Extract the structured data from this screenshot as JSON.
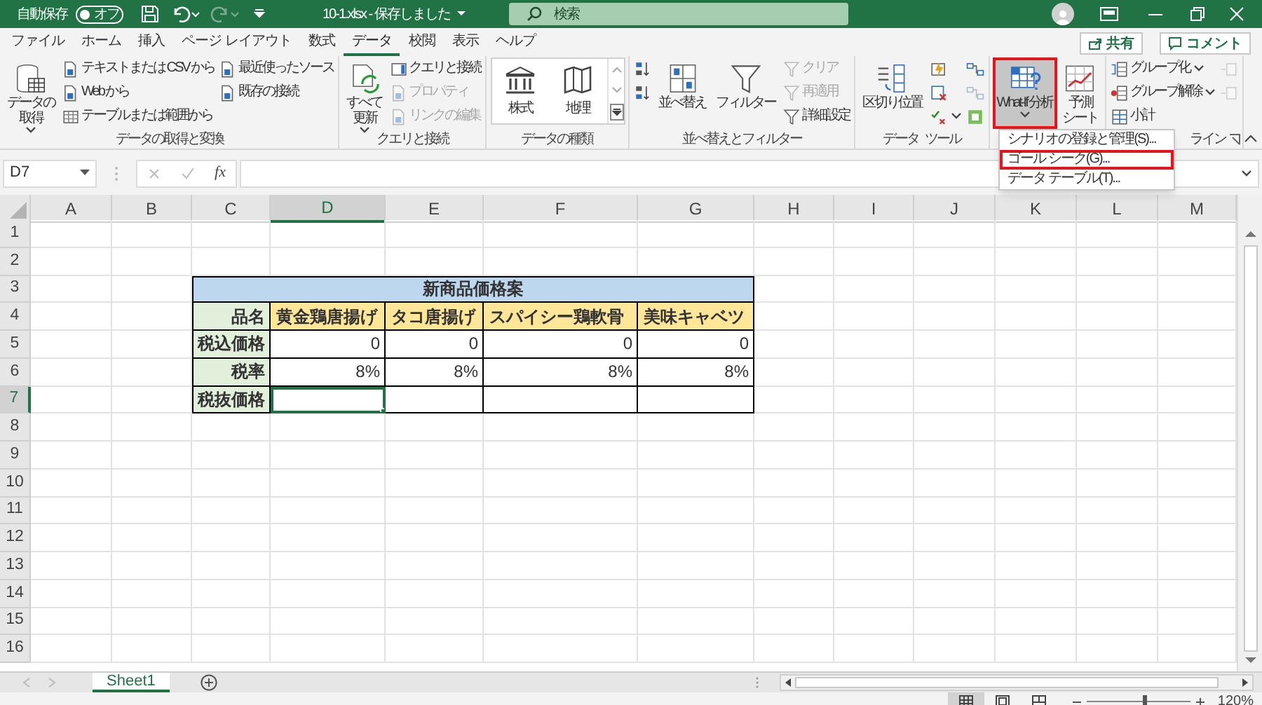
{
  "title_bar": {
    "autosave_label": "自動保存",
    "autosave": {
      "on": false,
      "label": "オフ"
    },
    "redo": {
      "disabled": true
    },
    "title": "10-1.xlsx - 保存しました",
    "search": {
      "placeholder": "検索"
    }
  },
  "menu_tabs": [
    {
      "label": "ファイル",
      "selected": false
    },
    {
      "label": "ホーム",
      "selected": false
    },
    {
      "label": "挿入",
      "selected": false
    },
    {
      "label": "ページ レイアウト",
      "selected": false
    },
    {
      "label": "数式",
      "selected": false
    },
    {
      "label": "データ",
      "selected": true
    },
    {
      "label": "校閲",
      "selected": false
    },
    {
      "label": "表示",
      "selected": false
    },
    {
      "label": "ヘルプ",
      "selected": false
    }
  ],
  "share_button": "共有",
  "comment_button": "コメント",
  "ribbon": {
    "groups": [
      {
        "label": "データの取得と変換",
        "items": [
          {
            "kind": "large",
            "lines": [
              "データの",
              "取得"
            ],
            "dropdown": true,
            "expanded": false,
            "highlighted": false
          },
          {
            "kind": "column",
            "buttons": [
              {
                "label": "テキストまたは CSV から",
                "disabled": false,
                "dropdown": false
              },
              {
                "label": "Web から",
                "disabled": false,
                "dropdown": false
              },
              {
                "label": "テーブルまたは範囲から",
                "disabled": false,
                "dropdown": false
              }
            ]
          },
          {
            "kind": "column",
            "buttons": [
              {
                "label": "最近使ったソース",
                "disabled": false,
                "dropdown": false
              },
              {
                "label": "既存の接続",
                "disabled": false,
                "dropdown": false
              }
            ]
          }
        ]
      },
      {
        "label": "クエリと接続",
        "items": [
          {
            "kind": "large",
            "lines": [
              "すべて",
              "更新"
            ],
            "dropdown": true,
            "expanded": false,
            "highlighted": false
          },
          {
            "kind": "column",
            "buttons": [
              {
                "label": "クエリと接続",
                "disabled": false,
                "dropdown": false
              },
              {
                "label": "プロパティ",
                "disabled": true,
                "dropdown": false
              },
              {
                "label": "リンクの編集",
                "disabled": true,
                "dropdown": false
              }
            ]
          }
        ]
      },
      {
        "label": "データの種類",
        "items": [
          {
            "kind": "gallery",
            "entries": [
              "株式",
              "地理"
            ]
          }
        ]
      },
      {
        "label": "並べ替えとフィルター",
        "items": [
          {
            "kind": "column",
            "buttons": [
              {
                "disabled": false,
                "dropdown": false
              },
              {
                "disabled": false,
                "dropdown": false
              }
            ]
          },
          {
            "kind": "large",
            "lines": [
              "並べ替え"
            ],
            "dropdown": false,
            "expanded": false,
            "highlighted": false
          },
          {
            "kind": "large",
            "lines": [
              "フィルター"
            ],
            "dropdown": false,
            "expanded": false,
            "highlighted": false
          },
          {
            "kind": "column",
            "buttons": [
              {
                "label": "クリア",
                "disabled": true,
                "dropdown": false
              },
              {
                "label": "再適用",
                "disabled": true,
                "dropdown": false
              },
              {
                "label": "詳細設定",
                "disabled": false,
                "dropdown": false
              }
            ]
          }
        ]
      },
      {
        "label": "データ ツール",
        "items": [
          {
            "kind": "large",
            "lines": [
              "区切り位置"
            ],
            "dropdown": false,
            "expanded": false,
            "highlighted": false
          },
          {
            "kind": "column",
            "buttons": [
              {
                "disabled": false,
                "dropdown": false
              },
              {
                "disabled": false,
                "dropdown": false
              },
              {
                "disabled": false,
                "dropdown": true
              }
            ]
          },
          {
            "kind": "column",
            "buttons": [
              {
                "disabled": false,
                "dropdown": false
              },
              {
                "disabled": true,
                "dropdown": false
              },
              {
                "disabled": false,
                "dropdown": false
              }
            ]
          }
        ]
      },
      {
        "items": [
          {
            "kind": "large",
            "lines": [
              "What-If 分析"
            ],
            "dropdown": true,
            "expanded": true,
            "highlighted": true
          },
          {
            "kind": "large",
            "lines": [
              "予測",
              "シート"
            ],
            "dropdown": false,
            "expanded": false,
            "highlighted": false
          }
        ]
      },
      {
        "label": "ライン",
        "items": [
          {
            "kind": "column",
            "buttons": [
              {
                "label": "グループ化",
                "disabled": false,
                "dropdown": true
              },
              {
                "label": "グループ解除",
                "disabled": false,
                "dropdown": true
              },
              {
                "label": "小計",
                "disabled": false,
                "dropdown": false
              }
            ]
          },
          {
            "kind": "column",
            "buttons": [
              {
                "disabled": true,
                "dropdown": false
              },
              {
                "disabled": true,
                "dropdown": false
              }
            ]
          }
        ]
      }
    ]
  },
  "what_if_menu": [
    {
      "label": "シナリオの登録と管理(S)...",
      "highlighted": false
    },
    {
      "label": "ゴール シーク(G)...",
      "highlighted": true
    },
    {
      "label": "データ テーブル(T)...",
      "highlighted": false
    }
  ],
  "formula_bar": {
    "name_box": "D7",
    "function_label": "fx"
  },
  "sheet": {
    "columns": [
      {
        "label": "A",
        "selected": false
      },
      {
        "label": "B",
        "selected": false
      },
      {
        "label": "C",
        "selected": false
      },
      {
        "label": "D",
        "selected": true
      },
      {
        "label": "E",
        "selected": false
      },
      {
        "label": "F",
        "selected": false
      },
      {
        "label": "G",
        "selected": false
      },
      {
        "label": "H",
        "selected": false
      },
      {
        "label": "I",
        "selected": false
      },
      {
        "label": "J",
        "selected": false
      },
      {
        "label": "K",
        "selected": false
      },
      {
        "label": "L",
        "selected": false
      },
      {
        "label": "M",
        "selected": false
      }
    ],
    "rows": [
      {
        "label": "1",
        "selected": false
      },
      {
        "label": "2",
        "selected": false
      },
      {
        "label": "3",
        "selected": false
      },
      {
        "label": "4",
        "selected": false
      },
      {
        "label": "5",
        "selected": false
      },
      {
        "label": "6",
        "selected": false
      },
      {
        "label": "7",
        "selected": true
      },
      {
        "label": "8",
        "selected": false
      },
      {
        "label": "9",
        "selected": false
      },
      {
        "label": "10",
        "selected": false
      },
      {
        "label": "11",
        "selected": false
      },
      {
        "label": "12",
        "selected": false
      },
      {
        "label": "13",
        "selected": false
      },
      {
        "label": "14",
        "selected": false
      },
      {
        "label": "15",
        "selected": false
      },
      {
        "label": "16",
        "selected": false
      }
    ]
  },
  "table": {
    "title": "新商品価格案",
    "header_label": "品名",
    "items": [
      "黄金鶏唐揚げ",
      "タコ唐揚げ",
      "スパイシー鶏軟骨",
      "美味キャベツ"
    ],
    "rows": [
      {
        "label": "税込価格",
        "cells": [
          {
            "text": "0",
            "selected": false
          },
          {
            "text": "0",
            "selected": false
          },
          {
            "text": "0",
            "selected": false
          },
          {
            "text": "0",
            "selected": false
          }
        ]
      },
      {
        "label": "税率",
        "cells": [
          {
            "text": "8%",
            "selected": false
          },
          {
            "text": "8%",
            "selected": false
          },
          {
            "text": "8%",
            "selected": false
          },
          {
            "text": "8%",
            "selected": false
          }
        ]
      },
      {
        "label": "税抜価格",
        "cells": [
          {
            "selected": true
          },
          {
            "selected": false
          },
          {
            "selected": false
          },
          {
            "selected": false
          }
        ]
      }
    ]
  },
  "sheet_tabs": [
    {
      "label": "Sheet1",
      "selected": true
    }
  ],
  "status_bar": {
    "views": [
      {
        "kind": "normal",
        "selected": true
      },
      {
        "kind": "page_layout",
        "selected": false
      },
      {
        "kind": "page_break",
        "selected": false
      }
    ],
    "zoom": {
      "level": 0.55,
      "reading": "120%"
    }
  }
}
